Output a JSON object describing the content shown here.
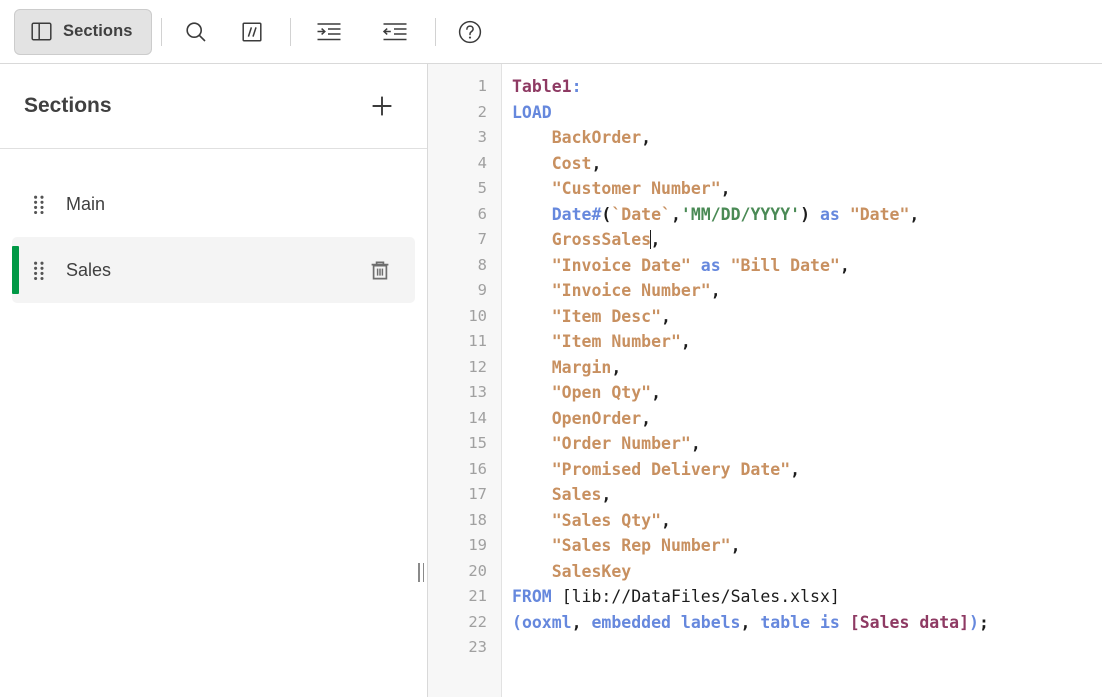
{
  "toolbar": {
    "sections_button": {
      "label": "Sections",
      "icon": "panel-layout-icon"
    },
    "buttons": [
      {
        "name": "search",
        "icon": "search-icon",
        "label": "Search"
      },
      {
        "name": "comment",
        "icon": "comment-slashes-icon",
        "label": "Comment"
      },
      {
        "name": "indent-increase",
        "icon": "indent-increase-icon",
        "label": "Increase indent"
      },
      {
        "name": "indent-decrease",
        "icon": "indent-decrease-icon",
        "label": "Decrease indent"
      },
      {
        "name": "help",
        "icon": "help-circle-icon",
        "label": "Help"
      }
    ]
  },
  "sidebar": {
    "title": "Sections",
    "add_icon": "plus-icon",
    "items": [
      {
        "label": "Main",
        "selected": false,
        "deletable": false
      },
      {
        "label": "Sales",
        "selected": true,
        "deletable": true
      }
    ]
  },
  "editor": {
    "line_numbers": [
      "1",
      "2",
      "3",
      "4",
      "5",
      "6",
      "7",
      "8",
      "9",
      "10",
      "11",
      "12",
      "13",
      "14",
      "15",
      "16",
      "17",
      "18",
      "19",
      "20",
      "21",
      "22",
      "23"
    ],
    "cursor": {
      "line": 7,
      "after_text": "GrossSales"
    },
    "script_text": "Table1:\nLOAD\n    BackOrder,\n    Cost,\n    \"Customer Number\",\n    Date#(`Date`,'MM/DD/YYYY') as \"Date\",\n    GrossSales,\n    \"Invoice Date\" as \"Bill Date\",\n    \"Invoice Number\",\n    \"Item Desc\",\n    \"Item Number\",\n    Margin,\n    \"Open Qty\",\n    OpenOrder,\n    \"Order Number\",\n    \"Promised Delivery Date\",\n    Sales,\n    \"Sales Qty\",\n    \"Sales Rep Number\",\n    SalesKey\nFROM [lib://DataFiles/Sales.xlsx]\n(ooxml, embedded labels, table is [Sales data]);\n",
    "lines": [
      {
        "n": "1",
        "tokens": [
          {
            "t": "Table1",
            "c": "tk-table"
          },
          {
            "t": ":",
            "c": "tk-kw"
          }
        ]
      },
      {
        "n": "2",
        "tokens": [
          {
            "t": "LOAD",
            "c": "tk-kw"
          }
        ]
      },
      {
        "n": "3",
        "tokens": [
          {
            "t": "    ",
            "c": "tk-plain"
          },
          {
            "t": "BackOrder",
            "c": "tk-field"
          },
          {
            "t": ",",
            "c": "tk-punct"
          }
        ]
      },
      {
        "n": "4",
        "tokens": [
          {
            "t": "    ",
            "c": "tk-plain"
          },
          {
            "t": "Cost",
            "c": "tk-field"
          },
          {
            "t": ",",
            "c": "tk-punct"
          }
        ]
      },
      {
        "n": "5",
        "tokens": [
          {
            "t": "    ",
            "c": "tk-plain"
          },
          {
            "t": "\"Customer Number\"",
            "c": "tk-field"
          },
          {
            "t": ",",
            "c": "tk-punct"
          }
        ]
      },
      {
        "n": "6",
        "tokens": [
          {
            "t": "    ",
            "c": "tk-plain"
          },
          {
            "t": "Date#",
            "c": "tk-kw"
          },
          {
            "t": "(",
            "c": "tk-punct"
          },
          {
            "t": "`Date`",
            "c": "tk-field"
          },
          {
            "t": ",",
            "c": "tk-punct"
          },
          {
            "t": "'MM/DD/YYYY'",
            "c": "tk-str"
          },
          {
            "t": ")",
            "c": "tk-punct"
          },
          {
            "t": " ",
            "c": "tk-plain"
          },
          {
            "t": "as",
            "c": "tk-kw"
          },
          {
            "t": " ",
            "c": "tk-plain"
          },
          {
            "t": "\"Date\"",
            "c": "tk-field"
          },
          {
            "t": ",",
            "c": "tk-punct"
          }
        ]
      },
      {
        "n": "7",
        "tokens": [
          {
            "t": "    ",
            "c": "tk-plain"
          },
          {
            "t": "GrossSales",
            "c": "tk-field"
          },
          {
            "t": "|caret|",
            "c": "caret"
          },
          {
            "t": ",",
            "c": "tk-punct"
          }
        ]
      },
      {
        "n": "8",
        "tokens": [
          {
            "t": "    ",
            "c": "tk-plain"
          },
          {
            "t": "\"Invoice Date\"",
            "c": "tk-field"
          },
          {
            "t": " ",
            "c": "tk-plain"
          },
          {
            "t": "as",
            "c": "tk-kw"
          },
          {
            "t": " ",
            "c": "tk-plain"
          },
          {
            "t": "\"Bill Date\"",
            "c": "tk-field"
          },
          {
            "t": ",",
            "c": "tk-punct"
          }
        ]
      },
      {
        "n": "9",
        "tokens": [
          {
            "t": "    ",
            "c": "tk-plain"
          },
          {
            "t": "\"Invoice Number\"",
            "c": "tk-field"
          },
          {
            "t": ",",
            "c": "tk-punct"
          }
        ]
      },
      {
        "n": "10",
        "tokens": [
          {
            "t": "    ",
            "c": "tk-plain"
          },
          {
            "t": "\"Item Desc\"",
            "c": "tk-field"
          },
          {
            "t": ",",
            "c": "tk-punct"
          }
        ]
      },
      {
        "n": "11",
        "tokens": [
          {
            "t": "    ",
            "c": "tk-plain"
          },
          {
            "t": "\"Item Number\"",
            "c": "tk-field"
          },
          {
            "t": ",",
            "c": "tk-punct"
          }
        ]
      },
      {
        "n": "12",
        "tokens": [
          {
            "t": "    ",
            "c": "tk-plain"
          },
          {
            "t": "Margin",
            "c": "tk-field"
          },
          {
            "t": ",",
            "c": "tk-punct"
          }
        ]
      },
      {
        "n": "13",
        "tokens": [
          {
            "t": "    ",
            "c": "tk-plain"
          },
          {
            "t": "\"Open Qty\"",
            "c": "tk-field"
          },
          {
            "t": ",",
            "c": "tk-punct"
          }
        ]
      },
      {
        "n": "14",
        "tokens": [
          {
            "t": "    ",
            "c": "tk-plain"
          },
          {
            "t": "OpenOrder",
            "c": "tk-field"
          },
          {
            "t": ",",
            "c": "tk-punct"
          }
        ]
      },
      {
        "n": "15",
        "tokens": [
          {
            "t": "    ",
            "c": "tk-plain"
          },
          {
            "t": "\"Order Number\"",
            "c": "tk-field"
          },
          {
            "t": ",",
            "c": "tk-punct"
          }
        ]
      },
      {
        "n": "16",
        "tokens": [
          {
            "t": "    ",
            "c": "tk-plain"
          },
          {
            "t": "\"Promised Delivery Date\"",
            "c": "tk-field"
          },
          {
            "t": ",",
            "c": "tk-punct"
          }
        ]
      },
      {
        "n": "17",
        "tokens": [
          {
            "t": "    ",
            "c": "tk-plain"
          },
          {
            "t": "Sales",
            "c": "tk-field"
          },
          {
            "t": ",",
            "c": "tk-punct"
          }
        ]
      },
      {
        "n": "18",
        "tokens": [
          {
            "t": "    ",
            "c": "tk-plain"
          },
          {
            "t": "\"Sales Qty\"",
            "c": "tk-field"
          },
          {
            "t": ",",
            "c": "tk-punct"
          }
        ]
      },
      {
        "n": "19",
        "tokens": [
          {
            "t": "    ",
            "c": "tk-plain"
          },
          {
            "t": "\"Sales Rep Number\"",
            "c": "tk-field"
          },
          {
            "t": ",",
            "c": "tk-punct"
          }
        ]
      },
      {
        "n": "20",
        "tokens": [
          {
            "t": "    ",
            "c": "tk-plain"
          },
          {
            "t": "SalesKey",
            "c": "tk-field"
          }
        ]
      },
      {
        "n": "21",
        "tokens": [
          {
            "t": "FROM",
            "c": "tk-kw"
          },
          {
            "t": " ",
            "c": "tk-plain"
          },
          {
            "t": "[lib://DataFiles/Sales.xlsx]",
            "c": "tk-path"
          }
        ]
      },
      {
        "n": "22",
        "tokens": [
          {
            "t": "(",
            "c": "tk-kw"
          },
          {
            "t": "ooxml",
            "c": "tk-kw"
          },
          {
            "t": ",",
            "c": "tk-punct"
          },
          {
            "t": " ",
            "c": "tk-plain"
          },
          {
            "t": "embedded labels",
            "c": "tk-kw"
          },
          {
            "t": ",",
            "c": "tk-punct"
          },
          {
            "t": " ",
            "c": "tk-plain"
          },
          {
            "t": "table is",
            "c": "tk-kw"
          },
          {
            "t": " ",
            "c": "tk-plain"
          },
          {
            "t": "[Sales data]",
            "c": "tk-brkt"
          },
          {
            "t": ")",
            "c": "tk-kw"
          },
          {
            "t": ";",
            "c": "tk-punct"
          }
        ]
      },
      {
        "n": "23",
        "tokens": []
      }
    ]
  },
  "colors": {
    "accent_green": "#009845",
    "keyword_blue": "#6688dd",
    "field_tan": "#c89060",
    "string_green": "#4a8a55",
    "table_maroon": "#8e3a63",
    "text_dark": "#404040",
    "gutter_bg": "#f7f7f7",
    "selected_bg": "#f4f4f4"
  }
}
